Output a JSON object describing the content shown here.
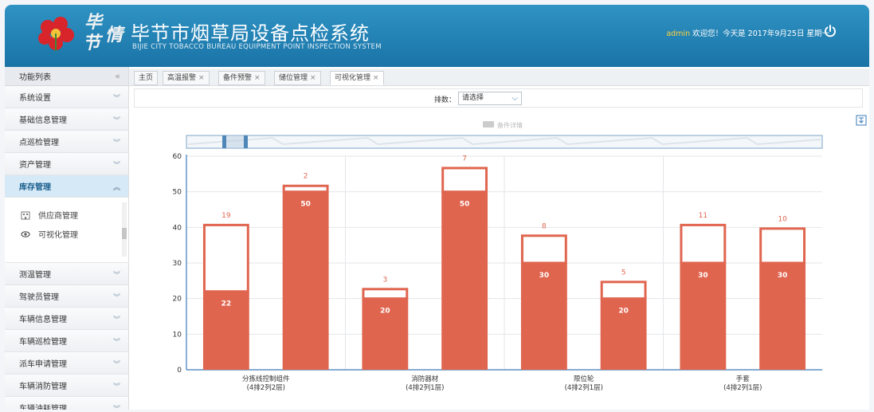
{
  "header": {
    "title": "毕节市烟草局设备点检系统",
    "subtitle": "BIJIE CITY TOBACCO BUREAU EQUIPMENT POINT INSPECTION SYSTEM",
    "logo_chars": [
      "毕",
      "节",
      "情"
    ],
    "user": "admin",
    "greeting": " 欢迎您！今天是 2017年9月25日 星期一"
  },
  "sidebar": {
    "title": "功能列表",
    "items": [
      {
        "label": "系统设置"
      },
      {
        "label": "基础信息管理"
      },
      {
        "label": "点巡检管理"
      },
      {
        "label": "资产管理"
      },
      {
        "label": "库存管理"
      },
      {
        "label": "测温管理"
      },
      {
        "label": "驾驶员管理"
      },
      {
        "label": "车辆信息管理"
      },
      {
        "label": "车辆巡检管理"
      },
      {
        "label": "派车申请管理"
      },
      {
        "label": "车辆消防管理"
      },
      {
        "label": "车辆油耗管理"
      }
    ],
    "submenu": [
      {
        "label": "供应商管理"
      },
      {
        "label": "可视化管理"
      }
    ]
  },
  "tabs": [
    {
      "label": "主页",
      "closable": false
    },
    {
      "label": "高温报警",
      "closable": true
    },
    {
      "label": "备件预警",
      "closable": true
    },
    {
      "label": "储位管理",
      "closable": true
    },
    {
      "label": "可视化管理",
      "closable": true
    }
  ],
  "filter": {
    "label": "排数：",
    "selected": "请选择"
  },
  "colors": {
    "bar": "#e0654f",
    "header": "#1f7fb3",
    "axis": "#3a7bb8"
  },
  "chart_data": {
    "type": "bar",
    "legend": [
      "备件详情"
    ],
    "ylim": [
      0,
      60
    ],
    "yticks": [
      0,
      10,
      20,
      30,
      40,
      50,
      60
    ],
    "categories": [
      "分拣线控制组件\n(4排2列2层)",
      "",
      "消防器材\n(4排2列1层)",
      "",
      "限位轮\n(4排2列1层)",
      "",
      "手套\n(4排2列1层)",
      ""
    ],
    "category_labels": [
      [
        "分拣线控制组件",
        "(4排2列2层)"
      ],
      [],
      [
        "消防器材",
        "(4排2列1层)"
      ],
      [],
      [
        "限位轮",
        "(4排2列1层)"
      ],
      [],
      [
        "手套",
        "(4排2列1层)"
      ],
      []
    ],
    "series": [
      {
        "values": [
          22,
          50,
          20,
          50,
          30,
          20,
          30,
          30
        ]
      },
      {
        "values": [
          19,
          2,
          3,
          7,
          8,
          5,
          11,
          10
        ]
      }
    ],
    "bar_labels": [
      "22",
      "50",
      "20",
      "50",
      "30",
      "20",
      "30",
      "30"
    ],
    "top_labels": [
      "19",
      "2",
      "3",
      "7",
      "8",
      "5",
      "11",
      "10"
    ],
    "zoom_slider": "visible"
  }
}
